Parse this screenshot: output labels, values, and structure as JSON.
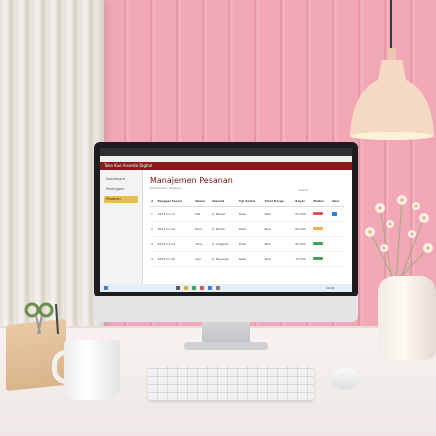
{
  "screen": {
    "brand": "Toko Kue Ananda Digital",
    "nav": [
      "Dashboard",
      "Pelanggan",
      "Pesanan"
    ],
    "active_nav": 2,
    "page_title": "Manajemen Pesanan",
    "breadcrumb": "Dashboard / Pesanan",
    "search_label": "Search:",
    "table": {
      "headers": [
        "#",
        "Tanggal Pesan",
        "Nama",
        "Alamat",
        "Tgl Ambil",
        "Total Harga",
        "Bayar",
        "Status",
        "Aksi"
      ],
      "rows": [
        [
          "1",
          "2023-11-11",
          "Nia",
          "Jl. Mawar",
          "Rasa",
          "Bolu",
          "87.000",
          "Belum",
          ""
        ],
        [
          "2",
          "2023-11-12",
          "Rina",
          "Jl. Melati",
          "Rasa",
          "Bolu",
          "60.000",
          "Proses",
          ""
        ],
        [
          "3",
          "2023-11-14",
          "Dina",
          "Jl. Anggrek",
          "Rasa",
          "Bolu",
          "85.000",
          "Selesai",
          ""
        ],
        [
          "4",
          "2023-11-15",
          "Sari",
          "Jl. Kenanga",
          "Rasa",
          "Bolu",
          "70.000",
          "Selesai",
          ""
        ]
      ]
    },
    "status_colors": {
      "Belum": "#d9534f",
      "Proses": "#f0ad4e",
      "Selesai": "#3aa35a"
    },
    "taskbar_time": "10:21"
  },
  "colors": {
    "wall": "#f2a7b6",
    "app_bar": "#8b1a1a",
    "active_nav": "#e7c047",
    "monitor": "#1d1d1f",
    "lamp": "#f6d9c4"
  },
  "objects": [
    "curtain-icon",
    "lamp-icon",
    "monitor-icon",
    "keyboard-icon",
    "mouse-icon",
    "mug-icon",
    "pen-holder-icon",
    "flower-vase-icon"
  ]
}
